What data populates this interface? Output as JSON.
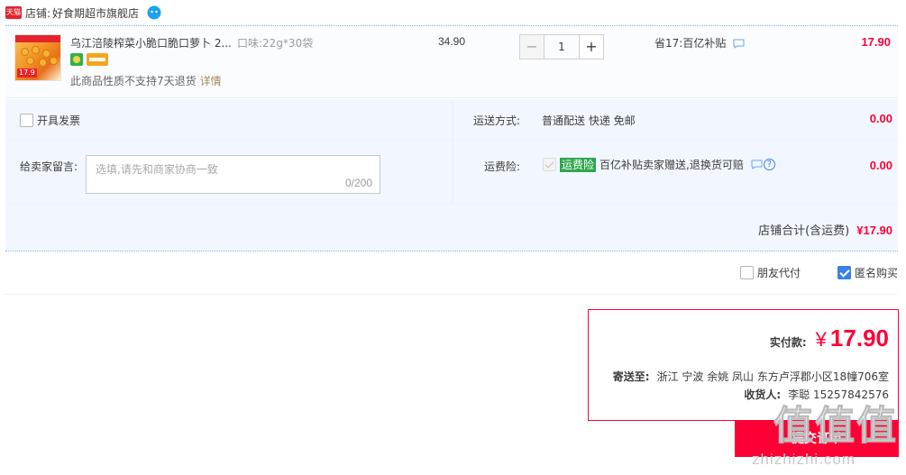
{
  "shop": {
    "badge": "天猫",
    "label": "店铺:",
    "name": "好食期超市旗舰店"
  },
  "item": {
    "title": "乌江涪陵榨菜小脆口脆口萝卜 2...",
    "sku": "口味:22g*30袋",
    "thumb_price": "17.9",
    "note": "此商品性质不支持7天退货",
    "note_link": "详情",
    "price": "34.90",
    "quantity": "1",
    "minus": "−",
    "plus": "+",
    "discount": "省17:百亿补贴",
    "total": "17.90"
  },
  "options": {
    "invoice_label": "开具发票",
    "message_label": "给卖家留言:",
    "message_placeholder": "选填,请先和商家协商一致",
    "message_count": "0/200",
    "shipping_label": "运送方式:",
    "shipping_value": "普通配送 快递 免邮",
    "shipping_price": "0.00",
    "insurance_label": "运费险:",
    "insurance_tag": "运费险",
    "insurance_text": "百亿补贴卖家赠送,退换货可赔",
    "insurance_price": "0.00",
    "question_mark": "?",
    "shop_total_label": "店铺合计(含运费)",
    "shop_total_amount": "¥17.90"
  },
  "checkout": {
    "friend_pay": "朋友代付",
    "anonymous": "匿名购买",
    "pay_label": "实付款:",
    "currency": "¥",
    "pay_amount": "17.90",
    "address_label": "寄送至:",
    "address": "浙江 宁波 余姚 凤山 东方卢浮郡小区18幢706室",
    "receiver_label": "收货人:",
    "receiver": "李聪 15257842576",
    "submit": "提交订单"
  },
  "watermark": {
    "text": "值值值",
    "url": "zhizhizhi.com"
  },
  "colors": {
    "accent_red": "#ff0036",
    "tmall_red": "#e5232c",
    "link_blue": "#3a80e8",
    "insurance_green": "#2fa64e"
  }
}
